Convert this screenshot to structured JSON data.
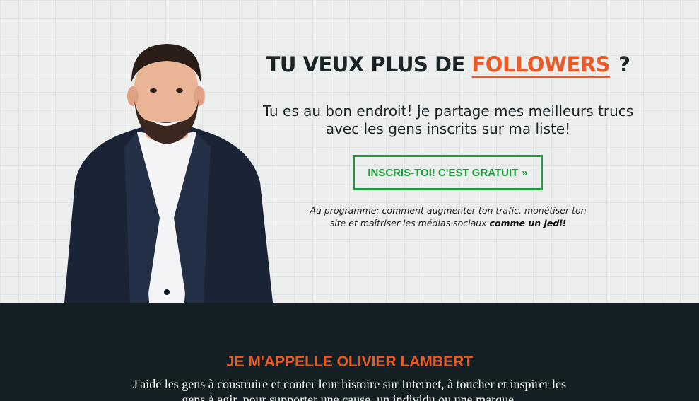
{
  "hero": {
    "headline_prefix": "TU VEUX PLUS DE",
    "headline_highlight": "FOLLOWERS",
    "headline_suffix": "?",
    "subtitle_line1": "Tu es au bon endroit! Je partage mes meilleurs trucs",
    "subtitle_line2": "avec les gens inscrits sur ma liste!",
    "cta_label": "INSCRIS-TOI! C'EST GRATUIT",
    "cta_chevron": "»",
    "note_line1": "Au programme: comment augmenter ton trafic, monétiser ton",
    "note_line2": "site et maîtriser les médias sociaux",
    "note_emphasis": "comme un jedi!"
  },
  "about": {
    "title": "JE M'APPELLE OLIVIER LAMBERT",
    "bio_line1": "J'aide les gens à construire et conter leur histoire sur Internet, à toucher et inspirer les",
    "bio_line2": "gens à agir, pour supporter une cause, un individu ou une marque."
  },
  "colors": {
    "accent": "#e95a26",
    "cta_green": "#1f9a3a",
    "dark_bg": "#142023",
    "hero_bg": "#eceeed"
  }
}
